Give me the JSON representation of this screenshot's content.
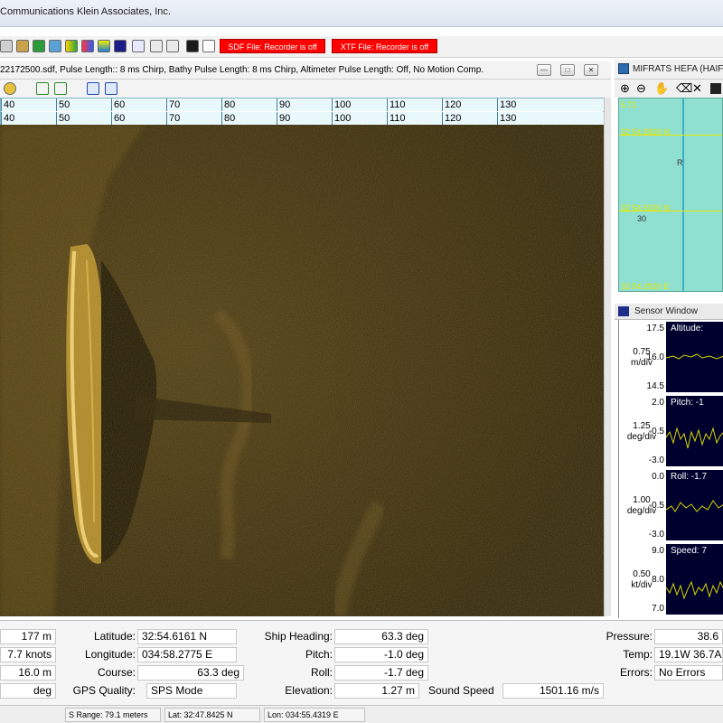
{
  "window": {
    "title": "Communications Klein Associates, Inc."
  },
  "toolbar": {
    "sdf_status": "SDF File: Recorder is off",
    "xtf_status": "XTF File: Recorder is off"
  },
  "sonar": {
    "header": "22172500.sdf, Pulse Length:: 8 ms Chirp, Bathy Pulse Length: 8 ms Chirp, Altimeter Pulse Length: Off, No Motion Comp.",
    "ruler_top": [
      "40",
      "50",
      "60",
      "70",
      "80",
      "90",
      "100",
      "110",
      "120",
      "130"
    ],
    "ruler_bottom": [
      "40",
      "50",
      "60",
      "70",
      "80",
      "90",
      "100",
      "110",
      "120",
      "130"
    ],
    "units": "meters"
  },
  "map": {
    "title": "MIFRATS HEFA (HAIFA",
    "lat_top": "32 54.5920 N",
    "lat_bottom": "32 54.5020 N",
    "label_r": "R",
    "label_depth": "30",
    "corner_top": "5.71",
    "corner_bottom": "32 54.2520 E"
  },
  "sensor": {
    "title": "Sensor Window",
    "panels": [
      {
        "scale_value": "0.75",
        "scale_unit": "m/div",
        "ticks": [
          "17.5",
          "16.0",
          "14.5"
        ],
        "label": "Altitude: "
      },
      {
        "scale_value": "1.25",
        "scale_unit": "deg/div",
        "ticks": [
          "2.0",
          "-0.5",
          "-3.0"
        ],
        "label": "Pitch: -1"
      },
      {
        "scale_value": "1.00",
        "scale_unit": "deg/div",
        "ticks": [
          "0.0",
          "-0.5",
          "-3.0"
        ],
        "label": "Roll: -1.7"
      },
      {
        "scale_value": "0.50",
        "scale_unit": "kt/div",
        "ticks": [
          "9.0",
          "8.0",
          "7.0"
        ],
        "label": "Speed: 7"
      }
    ]
  },
  "status": {
    "col1": [
      "177 m",
      "7.7 knots",
      "16.0 m",
      "deg"
    ],
    "latitude_label": "Latitude:",
    "latitude": "32:54.6161 N",
    "longitude_label": "Longitude:",
    "longitude": "034:58.2775 E",
    "course_label": "Course:",
    "course": "63.3 deg",
    "gps_label": "GPS Quality:",
    "gps": "SPS Mode",
    "heading_label": "Ship Heading:",
    "heading": "63.3 deg",
    "pitch_label": "Pitch:",
    "pitch": "-1.0 deg",
    "roll_label": "Roll:",
    "roll": "-1.7 deg",
    "elevation_label": "Elevation:",
    "elevation": "1.27 m",
    "sound_label": "Sound Speed",
    "sound": "1501.16 m/s",
    "pressure_label": "Pressure:",
    "pressure": "38.6",
    "temp_label": "Temp:",
    "temp": "19.1W 36.7A",
    "errors_label": "Errors:",
    "errors": "No Errors"
  },
  "statusbar": {
    "range": "S Range: 79.1 meters",
    "lat": "Lat: 32:47.8425 N",
    "lon": "Lon: 034:55.4319 E"
  },
  "colors": {
    "sonar_bg": "#362a10",
    "map_bg": "#8fe0d1",
    "recorder_off": "#ff0000",
    "sensor_plot": "#00002e",
    "trace": "#d8d800"
  }
}
